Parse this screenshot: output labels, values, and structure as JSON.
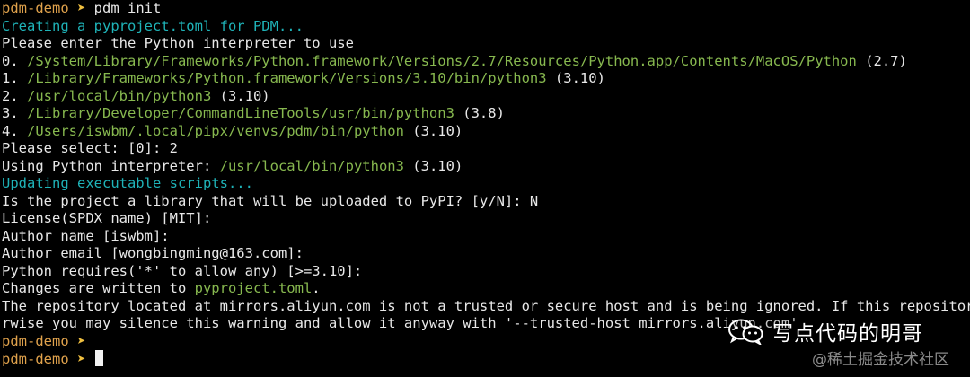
{
  "terminal": {
    "lines": [
      [
        {
          "t": "pdm-demo ",
          "c": "c-orange"
        },
        {
          "t": "➤",
          "c": "prompt-arrow"
        },
        {
          "t": " pdm init",
          "c": "c-white"
        }
      ],
      [
        {
          "t": "Creating a pyproject.toml for PDM...",
          "c": "c-cyan"
        }
      ],
      [
        {
          "t": "Please enter the Python interpreter to use",
          "c": "c-white"
        }
      ],
      [
        {
          "t": "0. ",
          "c": "c-white"
        },
        {
          "t": "/System/Library/Frameworks/Python.framework/Versions/2.7/Resources/Python.app/Contents/MacOS/Python",
          "c": "c-green"
        },
        {
          "t": " (2.7)",
          "c": "c-white"
        }
      ],
      [
        {
          "t": "1. ",
          "c": "c-white"
        },
        {
          "t": "/Library/Frameworks/Python.framework/Versions/3.10/bin/python3",
          "c": "c-green"
        },
        {
          "t": " (3.10)",
          "c": "c-white"
        }
      ],
      [
        {
          "t": "2. ",
          "c": "c-white"
        },
        {
          "t": "/usr/local/bin/python3",
          "c": "c-green"
        },
        {
          "t": " (3.10)",
          "c": "c-white"
        }
      ],
      [
        {
          "t": "3. ",
          "c": "c-white"
        },
        {
          "t": "/Library/Developer/CommandLineTools/usr/bin/python3",
          "c": "c-green"
        },
        {
          "t": " (3.8)",
          "c": "c-white"
        }
      ],
      [
        {
          "t": "4. ",
          "c": "c-white"
        },
        {
          "t": "/Users/iswbm/.local/pipx/venvs/pdm/bin/python",
          "c": "c-green"
        },
        {
          "t": " (3.10)",
          "c": "c-white"
        }
      ],
      [
        {
          "t": "Please select: [0]: 2",
          "c": "c-white"
        }
      ],
      [
        {
          "t": "Using Python interpreter: ",
          "c": "c-white"
        },
        {
          "t": "/usr/local/bin/python3",
          "c": "c-green"
        },
        {
          "t": " (3.10)",
          "c": "c-white"
        }
      ],
      [
        {
          "t": "Updating executable scripts...",
          "c": "c-cyan"
        }
      ],
      [
        {
          "t": "Is the project a library that will be uploaded to PyPI? [y/N]: N",
          "c": "c-white"
        }
      ],
      [
        {
          "t": "License(SPDX name) [MIT]:",
          "c": "c-white"
        }
      ],
      [
        {
          "t": "Author name [iswbm]:",
          "c": "c-white"
        }
      ],
      [
        {
          "t": "Author email [wongbingming@163.com]:",
          "c": "c-white"
        }
      ],
      [
        {
          "t": "Python requires('*' to allow any) [>=3.10]:",
          "c": "c-white"
        }
      ],
      [
        {
          "t": "Changes are written to ",
          "c": "c-white"
        },
        {
          "t": "pyproject.toml",
          "c": "c-green"
        },
        {
          "t": ".",
          "c": "c-white"
        }
      ],
      [
        {
          "t": "The repository located at mirrors.aliyun.com is not a trusted or secure host and is being ignored. If this repository i",
          "c": "c-white"
        }
      ],
      [
        {
          "t": "rwise you may silence this warning and allow it anyway with '--trusted-host mirrors.aliyun.com'",
          "c": "c-white"
        }
      ],
      [
        {
          "t": "pdm-demo ",
          "c": "c-orange"
        },
        {
          "t": "➤",
          "c": "prompt-arrow"
        }
      ],
      [
        {
          "t": "pdm-demo ",
          "c": "c-orange"
        },
        {
          "t": "➤ ",
          "c": "prompt-arrow"
        }
      ]
    ]
  },
  "watermark": {
    "text": "写点代码的明哥",
    "icon": "wechat-icon"
  },
  "juejin": {
    "text": "@稀土掘金技术社区"
  },
  "colors": {
    "background": "#000000",
    "text": "#e8e8e8",
    "cyan": "#1fb3b8",
    "green": "#87b84f",
    "prompt": "#e0a24c"
  }
}
